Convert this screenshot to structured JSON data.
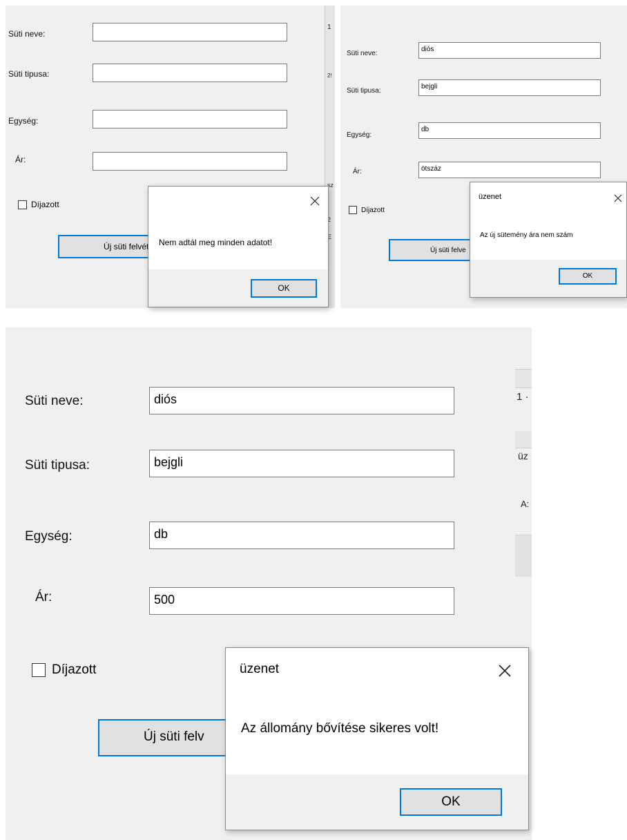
{
  "panel1": {
    "labels": {
      "name": "Süti neve:",
      "type": "Süti tipusa:",
      "unit": "Egység:",
      "price": "Ár:"
    },
    "values": {
      "name": "",
      "type": "",
      "unit": "",
      "price": ""
    },
    "checkbox_label": "Díjazott",
    "button_label": "Új süti felvét",
    "bg_fragments": [
      "1",
      "2!",
      "sz",
      "2",
      "E"
    ],
    "dialog": {
      "title": "",
      "message": "Nem adtál meg minden adatot!",
      "ok_label": "OK"
    }
  },
  "panel2": {
    "labels": {
      "name": "Süti neve:",
      "type": "Süti tipusa:",
      "unit": "Egység:",
      "price": "Ár:"
    },
    "values": {
      "name": "diós",
      "type": "bejgli",
      "unit": "db",
      "price": "ötszáz"
    },
    "checkbox_label": "Díjazott",
    "button_label": "Új süti felve",
    "dialog": {
      "title": "üzenet",
      "message": "Az új sütemény ára nem szám",
      "ok_label": "OK"
    }
  },
  "panel3": {
    "labels": {
      "name": "Süti neve:",
      "type": "Süti tipusa:",
      "unit": "Egység:",
      "price": "Ár:"
    },
    "values": {
      "name": "diós",
      "type": "bejgli",
      "unit": "db",
      "price": "500"
    },
    "checkbox_label": "Díjazott",
    "button_label": "Új süti felv",
    "bg_fragments": [
      "1 ·",
      "üz",
      "A:"
    ],
    "dialog": {
      "title": "üzenet",
      "message": "Az állomány bővítése sikeres volt!",
      "ok_label": "OK"
    }
  },
  "icons": {
    "close": "close-icon"
  },
  "colors": {
    "accent": "#0078d7",
    "form_bg": "#f0f0f0",
    "field_border": "#7a7a7a"
  }
}
